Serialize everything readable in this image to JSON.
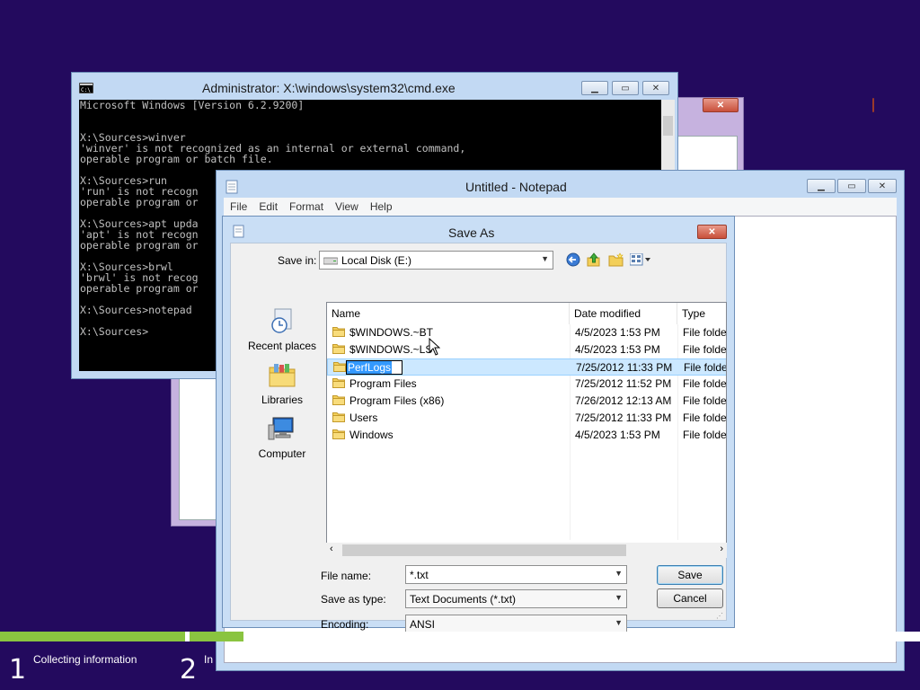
{
  "setup": {
    "steps": [
      {
        "number": "1",
        "label": "Collecting information"
      },
      {
        "number": "2",
        "label": "In"
      }
    ],
    "progress": 0.2
  },
  "cmd": {
    "title": "Administrator: X:\\windows\\system32\\cmd.exe",
    "icon": "console-icon",
    "lines": [
      "Microsoft Windows [Version 6.2.9200]",
      "",
      "",
      "X:\\Sources>winver",
      "'winver' is not recognized as an internal or external command,",
      "operable program or batch file.",
      "",
      "X:\\Sources>run",
      "'run' is not recogn",
      "operable program or",
      "",
      "X:\\Sources>apt upda",
      "'apt' is not recogn",
      "operable program or",
      "",
      "X:\\Sources>brwl",
      "'brwl' is not recog",
      "operable program or",
      "",
      "X:\\Sources>notepad",
      "",
      "X:\\Sources>"
    ]
  },
  "notepad": {
    "title": "Untitled - Notepad",
    "menu": [
      "File",
      "Edit",
      "Format",
      "View",
      "Help"
    ]
  },
  "save_dialog": {
    "title": "Save As",
    "save_in_label": "Save in:",
    "save_in_value": "Local Disk (E:)",
    "places": [
      "Recent places",
      "Libraries",
      "Computer"
    ],
    "columns": [
      "Name",
      "Date modified",
      "Type"
    ],
    "rows": [
      {
        "name": "$WINDOWS.~BT",
        "date": "4/5/2023 1:53 PM",
        "type": "File folder"
      },
      {
        "name": "$WINDOWS.~LS",
        "date": "4/5/2023 1:53 PM",
        "type": "File folder"
      },
      {
        "name": "PerfLogs",
        "date": "7/25/2012 11:33 PM",
        "type": "File folder",
        "selected": true
      },
      {
        "name": "Program Files",
        "date": "7/25/2012 11:52 PM",
        "type": "File folder"
      },
      {
        "name": "Program Files (x86)",
        "date": "7/26/2012 12:13 AM",
        "type": "File folder"
      },
      {
        "name": "Users",
        "date": "7/25/2012 11:33 PM",
        "type": "File folder"
      },
      {
        "name": "Windows",
        "date": "4/5/2023 1:53 PM",
        "type": "File folder"
      }
    ],
    "file_name_label": "File name:",
    "file_name_value": "*.txt",
    "save_type_label": "Save as type:",
    "save_type_value": "Text Documents (*.txt)",
    "encoding_label": "Encoding:",
    "encoding_value": "ANSI",
    "save_button": "Save",
    "cancel_button": "Cancel"
  },
  "colors": {
    "desktop": "#230a5e",
    "progress": "#8ac440",
    "selection": "#cce8ff"
  }
}
